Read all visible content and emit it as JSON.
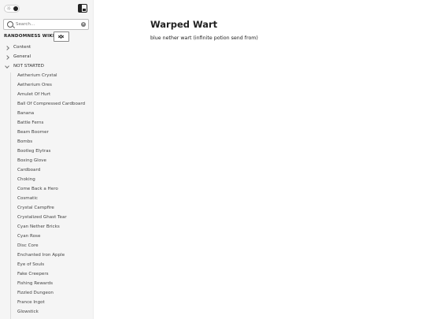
{
  "search": {
    "placeholder": "Search..."
  },
  "wiki": {
    "title": "RANDOMNESS WIKI!"
  },
  "folders": [
    {
      "label": "Content",
      "expanded": false
    },
    {
      "label": "General",
      "expanded": false
    },
    {
      "label": "NOT STARTED",
      "expanded": true
    }
  ],
  "pages": [
    "Aetherium Crystal",
    "Aetherium Ores",
    "Amulet Of Hurt",
    "Ball Of Compressed Cardboard",
    "Banana",
    "Battle Ferns",
    "Beam Boomer",
    "Bombs",
    "Bootleg Elytras",
    "Boxing Glove",
    "Cardboard",
    "Choking",
    "Come Back a Hero",
    "Cosmatic",
    "Crystal Campfire",
    "Crystalized Ghast Tear",
    "Cyan Nether Bricks",
    "Cyan Rose",
    "Disc Core",
    "Enchanted Iron Apple",
    "Eye of Souls",
    "Fake Creepers",
    "Fishing Rewards",
    "Fizzled Dungeon",
    "France Ingot",
    "Glowstick"
  ],
  "note": {
    "title": "Warped Wart",
    "body": "blue nether wart (infinite potion send from)"
  },
  "colors": {
    "sidebar_bg": "#f5f5f5",
    "text": "#222222"
  }
}
